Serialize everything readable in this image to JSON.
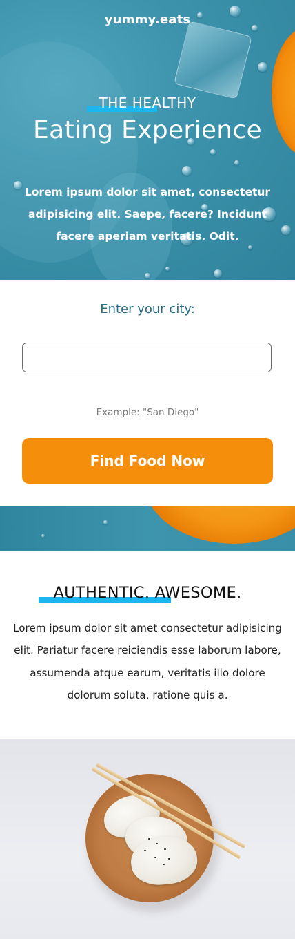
{
  "brand": {
    "logo": "yummy.eats"
  },
  "hero": {
    "eyebrow": "THE HEALTHY",
    "headline": "Eating Experience",
    "body": "Lorem ipsum dolor sit amet, consectetur adipisicing elit. Saepe, facere? Incidunt facere aperiam veritatis. Odit."
  },
  "search": {
    "label": "Enter your city:",
    "input_value": "",
    "example": "Example: \"San Diego\"",
    "button_label": "Find Food Now"
  },
  "about": {
    "title": "AUTHENTIC. AWESOME.",
    "body": "Lorem ipsum dolor sit amet consectetur adipisicing elit. Pariatur facere reiciendis esse laborum labore, assumenda atque earum, veritatis illo dolore dolorum soluta, ratione quis a."
  },
  "colors": {
    "hero_blue": "#3d93ac",
    "highlight": "#1cb6ee",
    "button_orange": "#f58f0b",
    "label_teal": "#256f86"
  },
  "images": {
    "hero": "water-drops-orange-photo",
    "band": "orange-slice-photo",
    "food": "dumplings-plate-photo"
  }
}
